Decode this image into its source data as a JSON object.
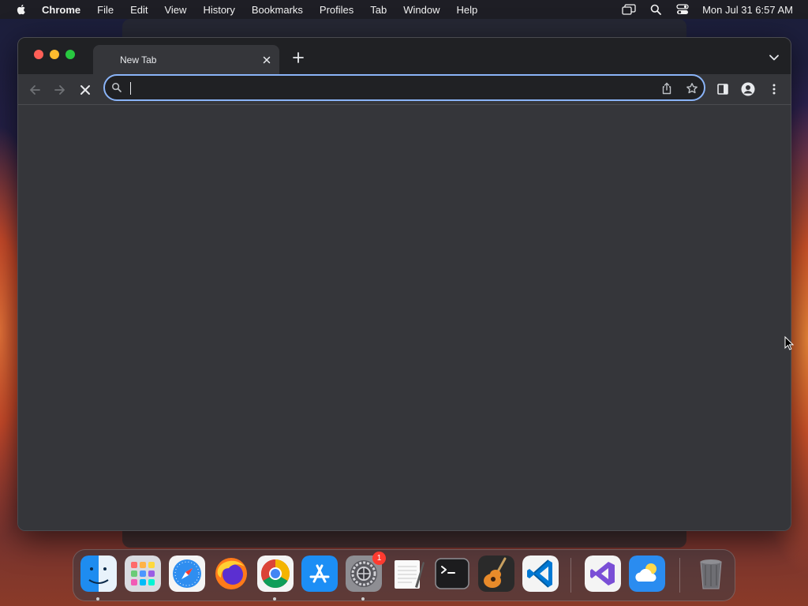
{
  "menubar": {
    "app_name": "Chrome",
    "items": [
      "File",
      "Edit",
      "View",
      "History",
      "Bookmarks",
      "Profiles",
      "Tab",
      "Window",
      "Help"
    ],
    "clock": "Mon Jul 31  6:57 AM"
  },
  "browser": {
    "tab": {
      "title": "New Tab"
    },
    "omnibox": {
      "value": "",
      "placeholder": ""
    }
  },
  "dock": {
    "items": [
      "Finder",
      "Launchpad",
      "Safari",
      "Firefox",
      "Google Chrome",
      "App Store",
      "System Settings",
      "TextEdit",
      "Terminal",
      "GarageBand",
      "Visual Studio Code",
      "Visual Studio",
      "Weather",
      "Trash"
    ],
    "system_settings_badge": "1"
  },
  "colors": {
    "accent_focus": "#8ab4f8",
    "window_bg": "#35363a",
    "tabstrip_bg": "#202124",
    "badge": "#ff3b30"
  }
}
